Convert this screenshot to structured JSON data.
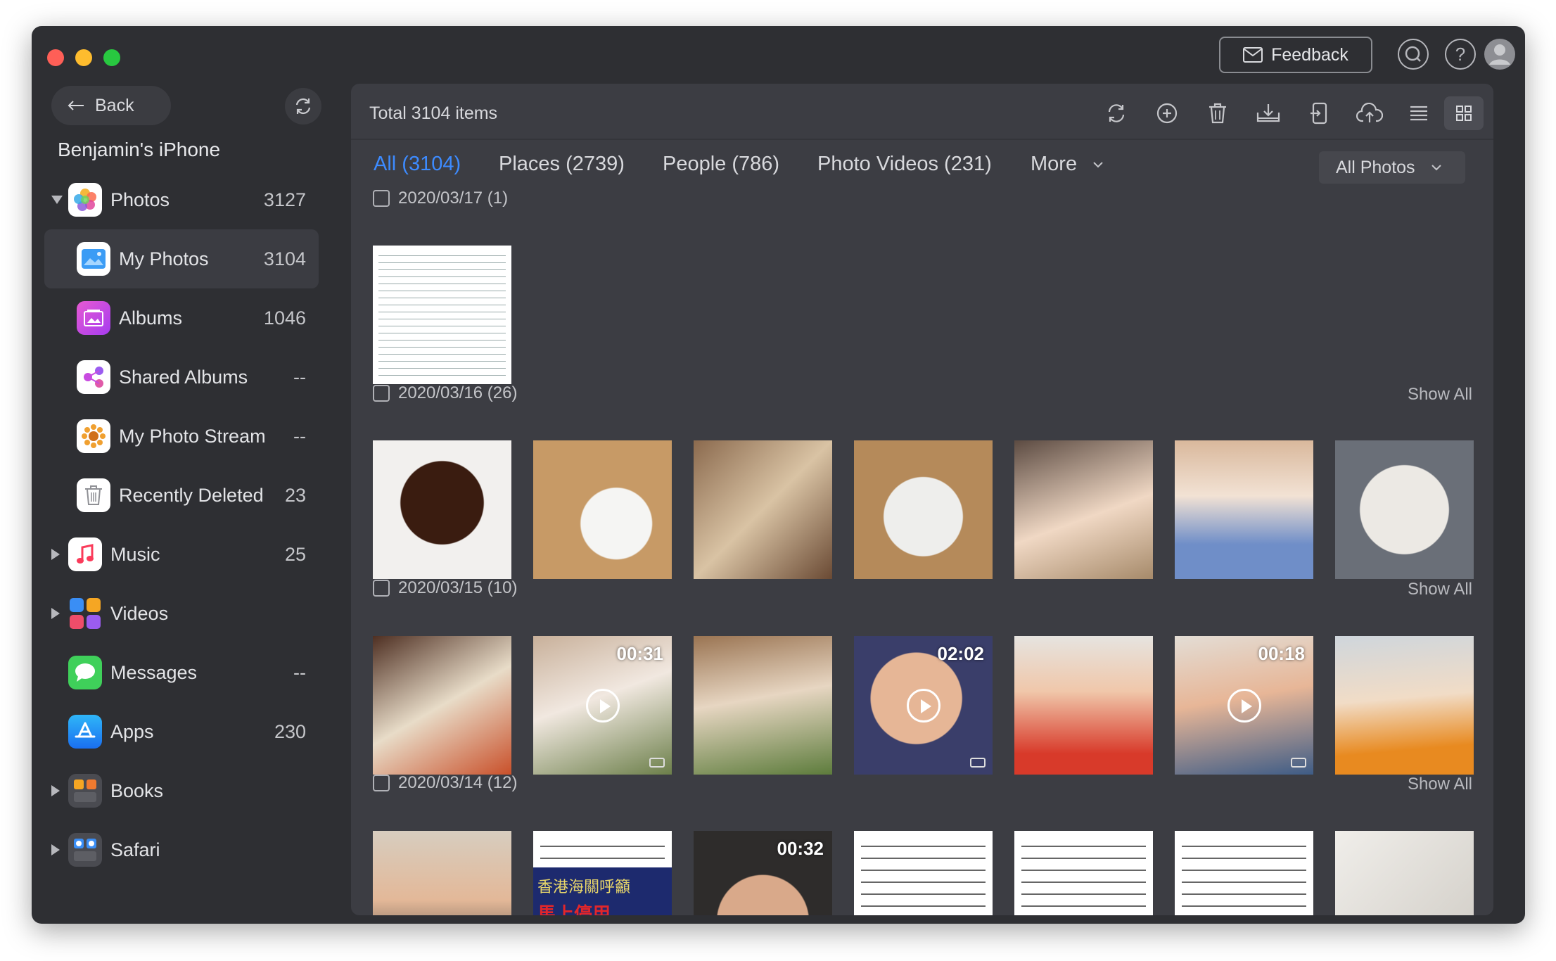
{
  "window": {
    "feedback_label": "Feedback",
    "top_icons": [
      "search-icon",
      "help-icon",
      "avatar"
    ]
  },
  "sidebar": {
    "back_label": "Back",
    "device_name": "Benjamin's iPhone",
    "items": [
      {
        "label": "Photos",
        "count": "3127",
        "icon": "photos-icon",
        "expanded": true
      },
      {
        "label": "My Photos",
        "count": "3104",
        "icon": "my-photos-icon",
        "selected": true
      },
      {
        "label": "Albums",
        "count": "1046",
        "icon": "albums-icon"
      },
      {
        "label": "Shared Albums",
        "count": "--",
        "icon": "shared-albums-icon"
      },
      {
        "label": "My Photo Stream",
        "count": "--",
        "icon": "photo-stream-icon"
      },
      {
        "label": "Recently Deleted",
        "count": "23",
        "icon": "trash-icon"
      },
      {
        "label": "Music",
        "count": "25",
        "icon": "music-icon"
      },
      {
        "label": "Videos",
        "count": "",
        "icon": "videos-icon"
      },
      {
        "label": "Messages",
        "count": "--",
        "icon": "messages-icon"
      },
      {
        "label": "Apps",
        "count": "230",
        "icon": "apps-icon"
      },
      {
        "label": "Books",
        "count": "",
        "icon": "books-icon"
      },
      {
        "label": "Safari",
        "count": "",
        "icon": "safari-icon"
      }
    ]
  },
  "main": {
    "total_label": "Total 3104 items",
    "toolbar": [
      "refresh-icon",
      "add-icon",
      "delete-icon",
      "export-to-pc-icon",
      "export-to-device-icon",
      "cloud-upload-icon",
      "list-view-icon",
      "grid-view-icon"
    ],
    "tabs": [
      {
        "label": "All (3104)",
        "active": true
      },
      {
        "label": "Places (2739)"
      },
      {
        "label": "People (786)"
      },
      {
        "label": "Photo Videos (231)"
      },
      {
        "label": "More"
      }
    ],
    "filter": "All Photos",
    "show_all_label": "Show All",
    "groups": [
      {
        "date": "2020/03/17 (1)",
        "show_all": false
      },
      {
        "date": "2020/03/16 (26)",
        "show_all": true
      },
      {
        "date": "2020/03/15 (10)",
        "show_all": true,
        "durations": [
          "00:31",
          "02:02",
          "00:18"
        ]
      },
      {
        "date": "2020/03/14 (12)",
        "show_all": true,
        "durations": [
          "00:32"
        ],
        "banner_text": "香港海關呼籲",
        "banner_text2": "馬上停用"
      }
    ]
  },
  "colors": {
    "accent": "#3d8bff",
    "window_bg": "#2e2f33",
    "panel_bg": "#3c3d43"
  }
}
